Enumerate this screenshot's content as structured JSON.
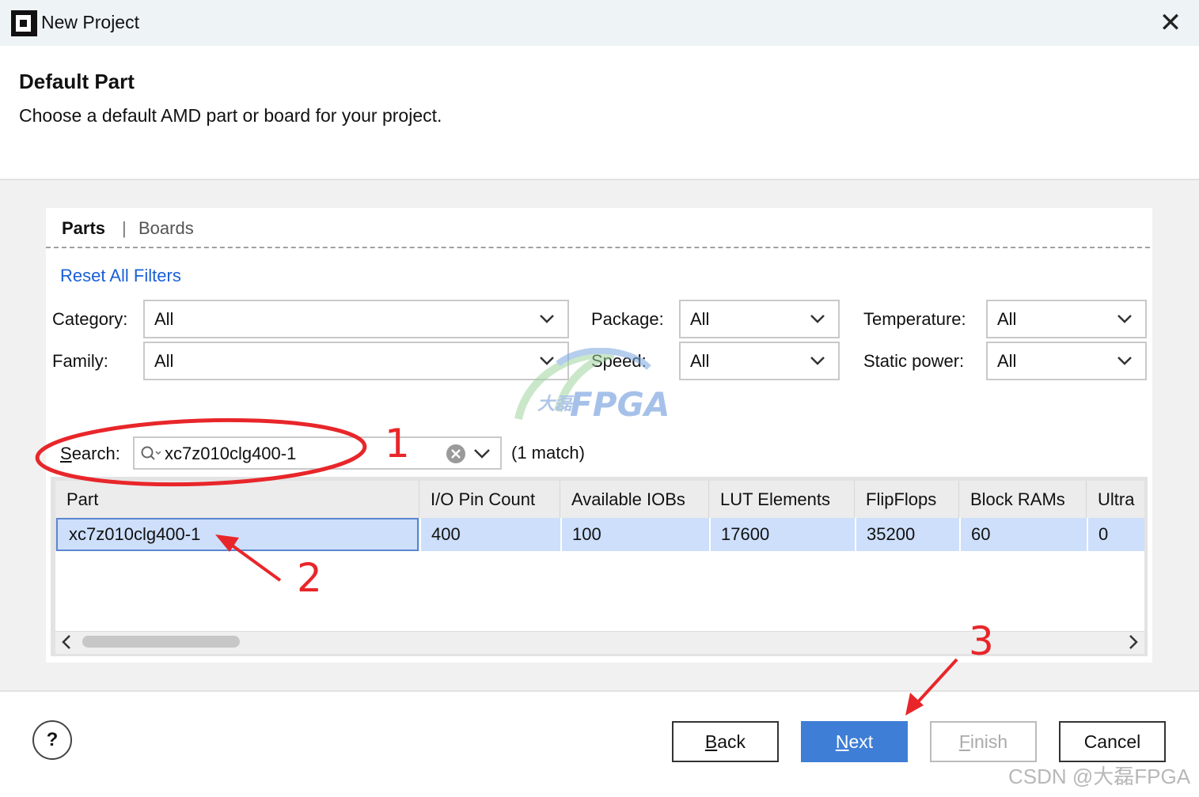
{
  "window": {
    "title": "New Project",
    "close_glyph": "✕"
  },
  "header": {
    "title": "Default Part",
    "subtitle": "Choose a default AMD part or board for your project."
  },
  "tabs": {
    "parts": "Parts",
    "separator": "|",
    "boards": "Boards"
  },
  "reset_filters": "Reset All Filters",
  "filters": {
    "category": {
      "label": "Category:",
      "value": "All"
    },
    "package": {
      "label": "Package:",
      "value": "All"
    },
    "temperature": {
      "label": "Temperature:",
      "value": "All"
    },
    "family": {
      "label": "Family:",
      "value": "All"
    },
    "speed": {
      "label": "Speed:",
      "value": "All"
    },
    "static_power": {
      "label": "Static power:",
      "value": "All"
    }
  },
  "search": {
    "label_accel": "S",
    "label_rest": "earch:",
    "value": "xc7z010clg400-1",
    "match_text": "(1 match)"
  },
  "table": {
    "columns": [
      "Part",
      "I/O Pin Count",
      "Available IOBs",
      "LUT Elements",
      "FlipFlops",
      "Block RAMs",
      "Ultra"
    ],
    "rows": [
      [
        "xc7z010clg400-1",
        "400",
        "100",
        "17600",
        "35200",
        "60",
        "0"
      ]
    ]
  },
  "buttons": {
    "help": "?",
    "back_accel": "B",
    "back_rest": "ack",
    "next_accel": "N",
    "next_rest": "ext",
    "finish_accel": "F",
    "finish_rest": "inish",
    "cancel": "Cancel"
  },
  "annotations": {
    "step1": "1",
    "step2": "2",
    "step3": "3",
    "color": "#e8262a"
  },
  "watermark": {
    "logo_text": "FPGA",
    "logo_cjk": "大磊"
  },
  "credit": "CSDN @大磊FPGA",
  "colors": {
    "accent": "#3f7ed6",
    "link": "#1a5fd6",
    "selection": "#cddffa"
  }
}
